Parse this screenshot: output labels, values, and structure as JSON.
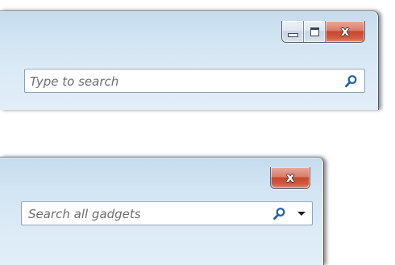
{
  "window_top": {
    "caption": {
      "minimize_label": "Minimize",
      "maximize_label": "Maximize",
      "close_label": "Close"
    },
    "search": {
      "placeholder": "Type to search",
      "icon": "search-icon"
    }
  },
  "window_bottom": {
    "caption": {
      "close_label": "Close"
    },
    "search": {
      "placeholder": "Search all gadgets",
      "icon": "search-icon",
      "dropdown_icon": "chevron-down-icon"
    }
  },
  "colors": {
    "frame": "#d2e4f2",
    "close_button": "#c7462e",
    "search_icon": "#1f5fae",
    "placeholder_text": "#6d6d6d"
  }
}
